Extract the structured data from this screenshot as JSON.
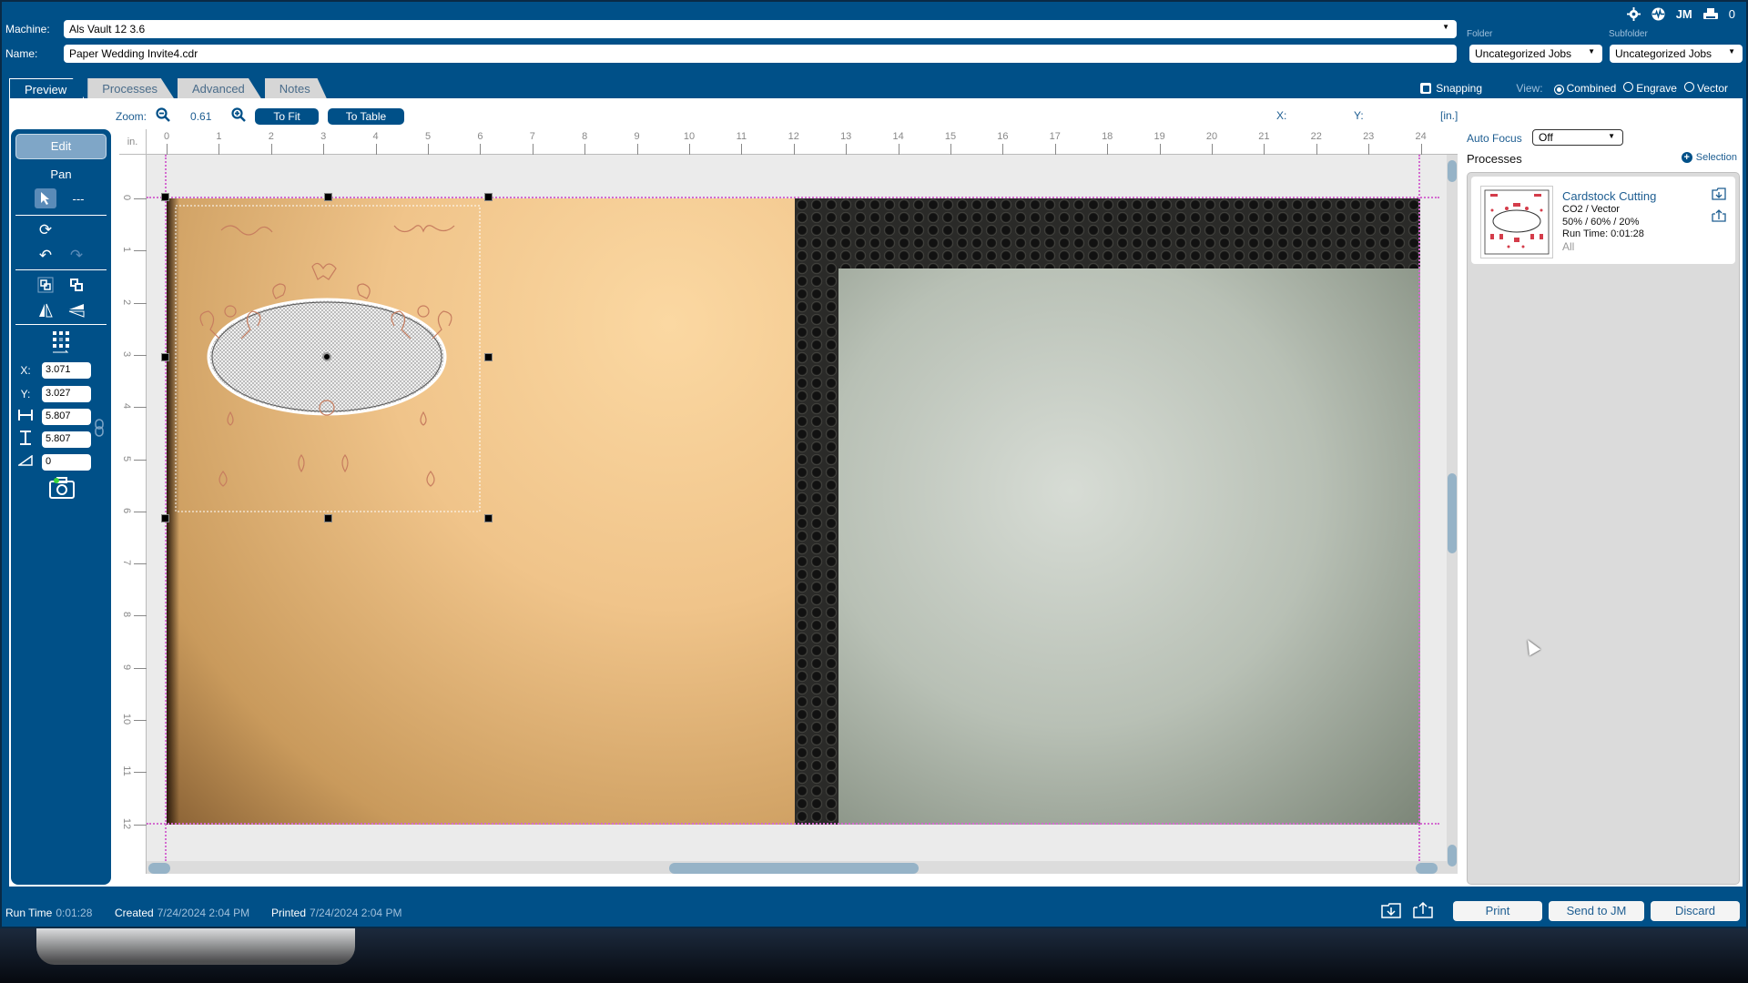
{
  "header": {
    "machine_label": "Machine:",
    "machine_value": "Als Vault 12 3.6",
    "name_label": "Name:",
    "name_value": "Paper Wedding Invite4.cdr",
    "folder_label": "Folder",
    "folder_value": "Uncategorized Jobs",
    "subfolder_label": "Subfolder",
    "subfolder_value": "Uncategorized Jobs",
    "icons": [
      "gear-icon",
      "activity-icon",
      "jm-icon",
      "printer-icon"
    ],
    "jm_text": "JM",
    "queue_count": "0"
  },
  "tabs": [
    {
      "label": "Preview",
      "active": true
    },
    {
      "label": "Processes",
      "active": false
    },
    {
      "label": "Advanced",
      "active": false
    },
    {
      "label": "Notes",
      "active": false
    }
  ],
  "view_options": {
    "snapping_label": "Snapping",
    "snapping_checked": true,
    "view_label": "View:",
    "modes": [
      {
        "label": "Combined",
        "selected": true
      },
      {
        "label": "Engrave",
        "selected": false
      },
      {
        "label": "Vector",
        "selected": false
      }
    ]
  },
  "zoom_bar": {
    "label": "Zoom:",
    "value": "0.61",
    "to_fit": "To Fit",
    "to_table": "To Table",
    "x_label": "X:",
    "y_label": "Y:",
    "units": "[in.]"
  },
  "tools": {
    "edit": "Edit",
    "pan": "Pan",
    "select_dash": "---",
    "x_label": "X:",
    "x_value": "3.071",
    "y_label": "Y:",
    "y_value": "3.027",
    "width_value": "5.807",
    "height_value": "5.807",
    "angle_value": "0"
  },
  "ruler": {
    "unit": "in.",
    "x_ticks": [
      "0",
      "1",
      "2",
      "3",
      "4",
      "5",
      "6",
      "7",
      "8",
      "9",
      "10",
      "11",
      "12",
      "13",
      "14",
      "15",
      "16",
      "17",
      "18",
      "19",
      "20",
      "21",
      "22",
      "23",
      "24"
    ],
    "y_ticks": [
      "0",
      "1",
      "2",
      "3",
      "4",
      "5",
      "6",
      "7",
      "8",
      "9",
      "10",
      "11",
      "12"
    ]
  },
  "right_panel": {
    "auto_focus_label": "Auto Focus",
    "auto_focus_value": "Off",
    "processes_title": "Processes",
    "selection_label": "Selection",
    "processes": [
      {
        "name": "Cardstock Cutting",
        "type": "CO2 / Vector",
        "settings": "50% / 60% / 20%",
        "run_time": "Run Time: 0:01:28",
        "scope": "All"
      }
    ]
  },
  "footer": {
    "run_time_label": "Run Time",
    "run_time_value": "0:01:28",
    "created_label": "Created",
    "created_value": "7/24/2024 2:04 PM",
    "printed_label": "Printed",
    "printed_value": "7/24/2024 2:04 PM",
    "print": "Print",
    "send_to_jm": "Send to JM",
    "discard": "Discard"
  }
}
